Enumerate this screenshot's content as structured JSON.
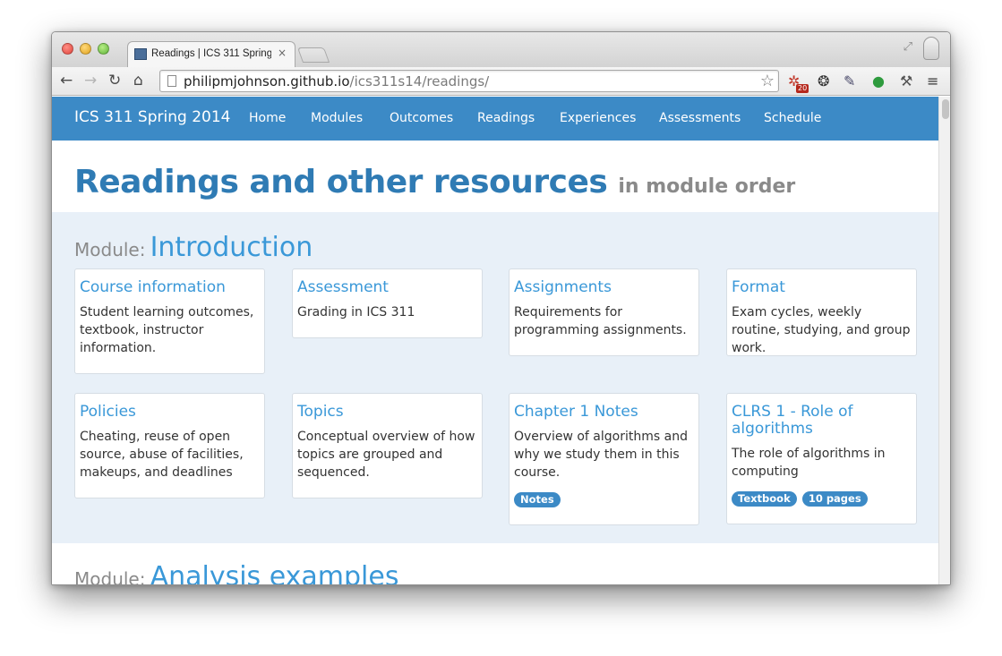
{
  "browser": {
    "tab_title": "Readings | ICS 311 Spring",
    "tab_close": "×",
    "url_host": "philipmjohnson.github.io",
    "url_path": "/ics311s14/readings/",
    "extension_badge": "20"
  },
  "site": {
    "brand": "ICS 311 Spring 2014",
    "nav": [
      "Home",
      "Modules",
      "Outcomes",
      "Readings",
      "Experiences",
      "Assessments",
      "Schedule"
    ]
  },
  "header": {
    "title": "Readings and other resources",
    "subtitle": "in module order"
  },
  "modules": [
    {
      "prefix": "Module:",
      "name": "Introduction",
      "cards": [
        {
          "title": "Course information",
          "desc": "Student learning outcomes, textbook, instructor information.",
          "badges": []
        },
        {
          "title": "Assessment",
          "desc": "Grading in ICS 311",
          "badges": []
        },
        {
          "title": "Assignments",
          "desc": "Requirements for programming assignments.",
          "badges": []
        },
        {
          "title": "Format",
          "desc": "Exam cycles, weekly routine, studying, and group work.",
          "badges": []
        },
        {
          "title": "Policies",
          "desc": "Cheating, reuse of open source, abuse of facilities, makeups, and deadlines",
          "badges": []
        },
        {
          "title": "Topics",
          "desc": "Conceptual overview of how topics are grouped and sequenced.",
          "badges": []
        },
        {
          "title": "Chapter 1 Notes",
          "desc": "Overview of algorithms and why we study them in this course.",
          "badges": [
            "Notes"
          ]
        },
        {
          "title": "CLRS 1 - Role of algorithms",
          "desc": "The role of algorithms in computing",
          "badges": [
            "Textbook",
            "10 pages"
          ]
        }
      ]
    },
    {
      "prefix": "Module:",
      "name": "Analysis examples"
    }
  ]
}
